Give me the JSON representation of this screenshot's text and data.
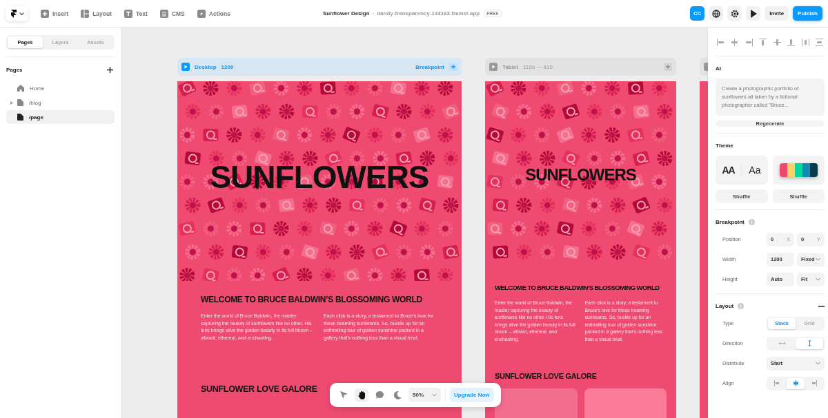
{
  "topbar": {
    "menu_items": [
      {
        "label": "Insert",
        "kind": "plus"
      },
      {
        "label": "Layout",
        "kind": "layout"
      },
      {
        "label": "Text",
        "kind": "text"
      },
      {
        "label": "CMS",
        "kind": "database"
      },
      {
        "label": "Actions",
        "kind": "bolt"
      }
    ],
    "project_title": "Sunflower Design",
    "separator": "·",
    "domain": "dandy-transparency-143163.framer.app",
    "plan_badge": "FREE",
    "avatar_initials": "CC",
    "invite": "Invite",
    "publish": "Publish"
  },
  "sidebar": {
    "tabs": [
      {
        "label": "Pages",
        "selected": true
      },
      {
        "label": "Layers",
        "selected": false
      },
      {
        "label": "Assets",
        "selected": false
      }
    ],
    "section_title": "Pages",
    "pages": [
      {
        "label": "Home",
        "kind": "home",
        "collapsible": false,
        "selected": false
      },
      {
        "label": "/blog",
        "kind": "page",
        "collapsible": true,
        "selected": false
      },
      {
        "label": "/page",
        "kind": "page",
        "collapsible": false,
        "selected": true
      }
    ]
  },
  "breakpoints": [
    {
      "kind": "desktop",
      "name": "Desktop",
      "size": "1200",
      "selected": true,
      "action_label": "Breakpoint",
      "page": {
        "hero_title": "SUNFLOWERS",
        "heading": "WELCOME TO BRUCE BALDWIN’S BLOSSOMING WORLD",
        "paragraphs": [
          "Enter the world of Bruce Baldwin, the master capturing the beauty of sunflowers like no other. His lens brings alive the golden beauty in its full bloom – vibrant, ethereal, and enchanting.",
          "Each click is a story, a testament to Bruce’s love for these beaming sunbeams. So, buckle up for an enthralling tour of golden sunshine packed in a gallery that’s nothing less than a visual treat."
        ],
        "section_heading": "SUNFLOWER LOVE GALORE",
        "gallery_visible": false
      }
    },
    {
      "kind": "tablet",
      "name": "Tablet",
      "size": "1199 — 810",
      "selected": false,
      "page": {
        "hero_title": "SUNFLOWERS",
        "heading": "WELCOME TO BRUCE BALDWIN’S BLOSSOMING WORLD",
        "paragraphs": [
          "Enter the world of Bruce Baldwin, the master capturing the beauty of sunflowers like no other. His lens brings alive the golden beauty in its full bloom – vibrant, ethereal, and enchanting.",
          "Each click is a story, a testament to Bruce’s love for these beaming sunbeams. So, buckle up for an enthralling tour of golden sunshine packed in a gallery that’s nothing less than a visual treat."
        ],
        "section_heading": "SUNFLOWER LOVE GALORE",
        "gallery_visible": true
      }
    }
  ],
  "canvas_toolbar": {
    "tools": [
      {
        "kind": "pointer",
        "selected": false
      },
      {
        "kind": "hand",
        "selected": true
      },
      {
        "kind": "comment",
        "selected": false
      },
      {
        "kind": "moon",
        "selected": false
      }
    ],
    "zoom": "50%",
    "upgrade": "Upgrade Now"
  },
  "properties": {
    "align_tools": [
      {
        "kind": "left"
      },
      {
        "kind": "center-h"
      },
      {
        "kind": "right"
      },
      {
        "kind": "top"
      },
      {
        "kind": "center-v"
      },
      {
        "kind": "bottom"
      },
      {
        "kind": "distribute-h"
      },
      {
        "kind": "distribute-v"
      }
    ],
    "ai": {
      "title": "AI",
      "prompt": "Create a photographic portfolio of sunflowers all taken by a fictional photographer called \"Bruce...",
      "button": "Regenerate"
    },
    "theme": {
      "title": "Theme",
      "font_samples": [
        "AA",
        "Aa"
      ],
      "palette": [
        {
          "color": "#ef476f"
        },
        {
          "color": "#ffd166"
        },
        {
          "color": "#06d6a0"
        },
        {
          "color": "#118ab2"
        },
        {
          "color": "#073b4c"
        }
      ],
      "shuffle_buttons": [
        "Shuffle",
        "Shuffle"
      ]
    },
    "breakpoint": {
      "title": "Breakpoint",
      "rows": [
        {
          "label": "Position",
          "fields": [
            {
              "kind": "input",
              "value": "0",
              "suffix": "X"
            },
            {
              "kind": "input",
              "value": "0",
              "suffix": "Y"
            }
          ]
        },
        {
          "label": "Width",
          "fields": [
            {
              "kind": "input",
              "value": "1200"
            },
            {
              "kind": "select",
              "value": "Fixed"
            }
          ]
        },
        {
          "label": "Height",
          "fields": [
            {
              "kind": "input",
              "value": "Auto"
            },
            {
              "kind": "select",
              "value": "Fit"
            }
          ]
        }
      ]
    },
    "layout": {
      "title": "Layout",
      "expanded": true,
      "rows": [
        {
          "label": "Type",
          "kind": "segmented",
          "options": [
            {
              "label": "Stack",
              "selected": true
            },
            {
              "label": "Grid",
              "selected": false
            }
          ]
        },
        {
          "label": "Direction",
          "kind": "segmented",
          "options": [
            {
              "kind": "horizontal",
              "selected": false
            },
            {
              "kind": "vertical",
              "selected": true
            }
          ]
        },
        {
          "label": "Distribute",
          "kind": "select",
          "value": "Start"
        },
        {
          "label": "Align",
          "kind": "segmented",
          "options": [
            {
              "kind": "start",
              "selected": false
            },
            {
              "kind": "center",
              "selected": true
            },
            {
              "kind": "end",
              "selected": false
            }
          ]
        }
      ]
    }
  }
}
